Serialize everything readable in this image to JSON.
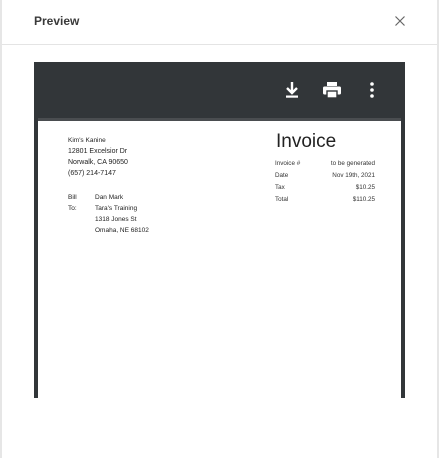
{
  "modal": {
    "title": "Preview",
    "close_icon": "close-icon"
  },
  "toolbar": {
    "icons": [
      "download-icon",
      "print-icon",
      "more-vert-icon"
    ]
  },
  "invoice": {
    "title": "Invoice",
    "from": {
      "name": "Kim's Kanine",
      "address1": "12801 Excelsior Dr",
      "city": "Norwalk, CA 90650",
      "phone": "(657) 214-7147"
    },
    "meta": [
      {
        "label": "Invoice #",
        "value": "to be generated"
      },
      {
        "label": "Date",
        "value": "Nov 19th, 2021"
      },
      {
        "label": "Tax",
        "value": "$10.25"
      },
      {
        "label": "Total",
        "value": "$110.25"
      }
    ],
    "bill_to": {
      "label": "Bill To:",
      "lines": [
        "Dan Mark",
        "Tara's Training",
        "1318 Jones St",
        "Omaha, NE 68102"
      ]
    }
  }
}
